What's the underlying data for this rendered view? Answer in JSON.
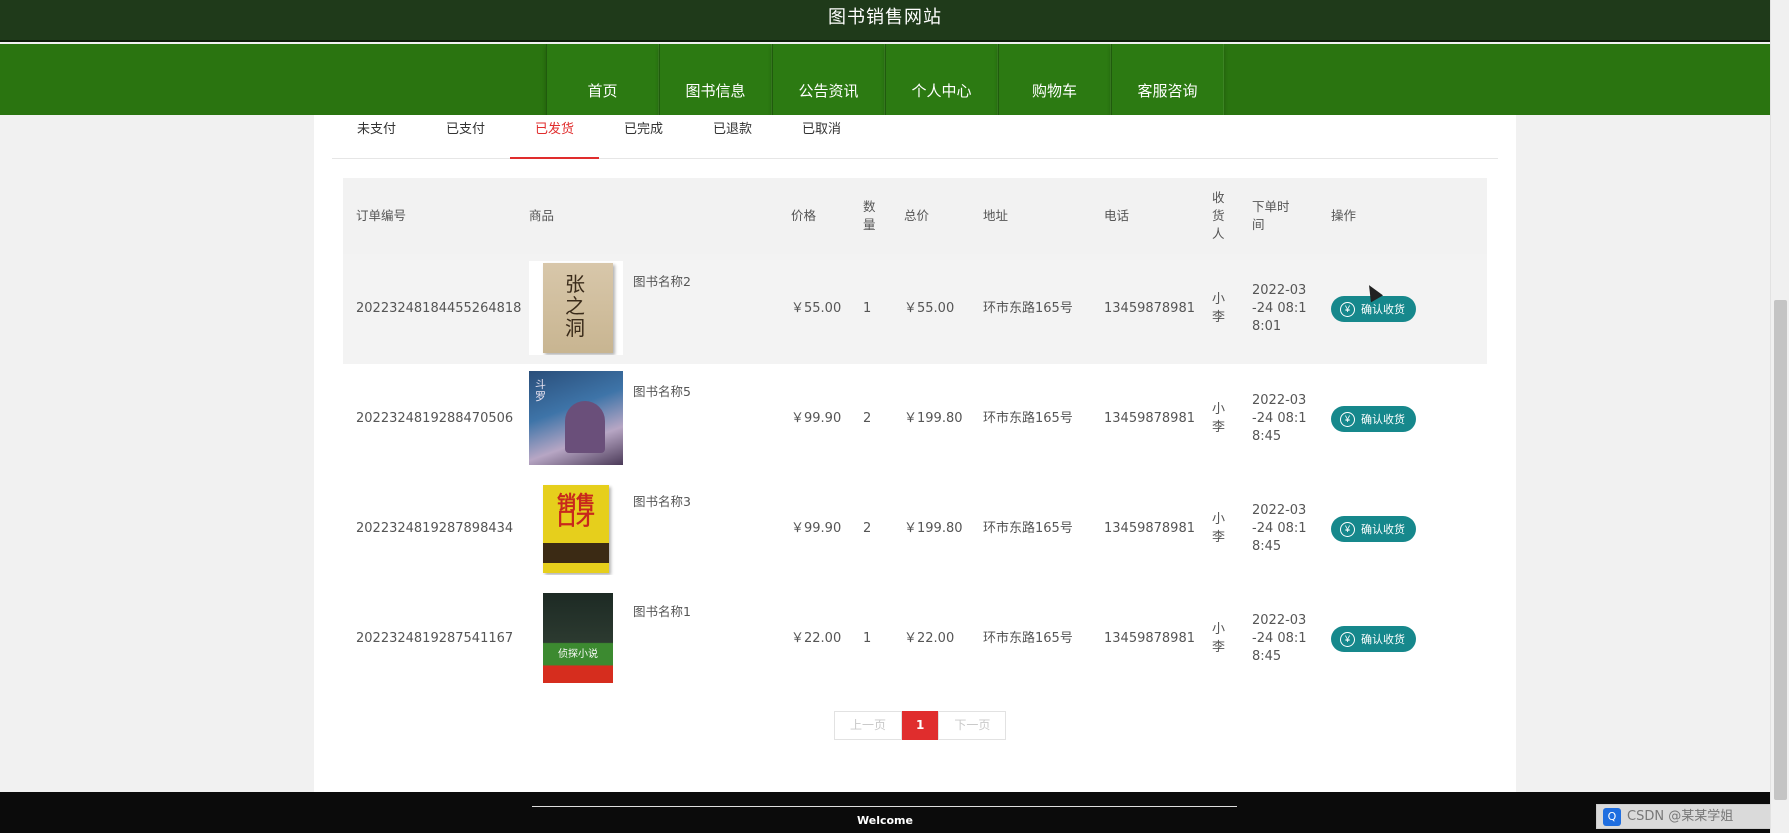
{
  "header": {
    "title": "图书销售网站"
  },
  "nav": {
    "items": [
      {
        "label": "首页"
      },
      {
        "label": "图书信息"
      },
      {
        "label": "公告资讯"
      },
      {
        "label": "个人中心"
      },
      {
        "label": "购物车"
      },
      {
        "label": "客服咨询"
      }
    ]
  },
  "tabs": {
    "items": [
      {
        "label": "未支付"
      },
      {
        "label": "已支付"
      },
      {
        "label": "已发货",
        "active": true
      },
      {
        "label": "已完成"
      },
      {
        "label": "已退款"
      },
      {
        "label": "已取消"
      }
    ]
  },
  "table": {
    "headers": {
      "order_no": "订单编号",
      "goods": "商品",
      "price": "价格",
      "qty": "数量",
      "total": "总价",
      "address": "地址",
      "phone": "电话",
      "receiver": "收货人",
      "order_time": "下单时间",
      "action": "操作"
    },
    "rows": [
      {
        "order_no": "2022324818445526481 8",
        "goods_name": "图书名称2",
        "price": "￥55.00",
        "qty": "1",
        "total": "￥55.00",
        "address": "环市东路165号",
        "phone": "13459878981",
        "receiver": "小李",
        "order_time": "2022-03-24 08:18:01",
        "action": "确认收货"
      },
      {
        "order_no": "2022324819288470506",
        "goods_name": "图书名称5",
        "price": "￥99.90",
        "qty": "2",
        "total": "￥199.80",
        "address": "环市东路165号",
        "phone": "13459878981",
        "receiver": "小李",
        "order_time": "2022-03-24 08:18:45",
        "action": "确认收货"
      },
      {
        "order_no": "2022324819287898434",
        "goods_name": "图书名称3",
        "price": "￥99.90",
        "qty": "2",
        "total": "￥199.80",
        "address": "环市东路165号",
        "phone": "13459878981",
        "receiver": "小李",
        "order_time": "2022-03-24 08:18:45",
        "action": "确认收货"
      },
      {
        "order_no": "2022324819287541167",
        "goods_name": "图书名称1",
        "price": "￥22.00",
        "qty": "1",
        "total": "￥22.00",
        "address": "环市东路165号",
        "phone": "13459878981",
        "receiver": "小李",
        "order_time": "2022-03-24 08:18:45",
        "action": "确认收货"
      }
    ]
  },
  "covers": {
    "c1": "张之洞",
    "c2": "斗罗",
    "c3": "销售口才",
    "c4": "侦探小说"
  },
  "pagination": {
    "prev": "上一页",
    "current": "1",
    "next": "下一页"
  },
  "footer": {
    "welcome": "Welcome",
    "watermark": "CSDN @某某学姐"
  },
  "colors": {
    "nav_green": "#2a7410",
    "accent_red": "#e02d2d",
    "button_teal": "#16888c"
  }
}
